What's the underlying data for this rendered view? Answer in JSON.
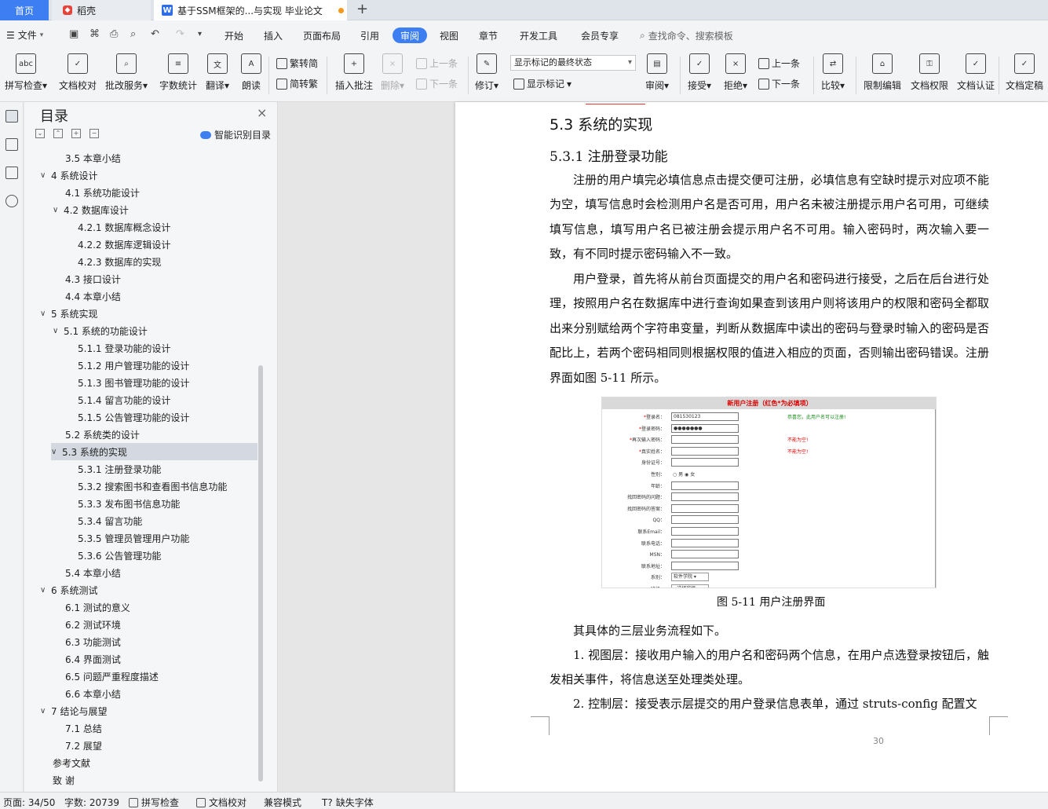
{
  "tabs": {
    "home": "首页",
    "daoke": "稻壳",
    "document": "基于SSM框架的...与实现 毕业论文"
  },
  "menu": {
    "file": "文件",
    "items": [
      "开始",
      "插入",
      "页面布局",
      "引用"
    ],
    "active": "审阅",
    "items2": [
      "视图",
      "章节",
      "开发工具",
      "会员专享"
    ],
    "search": "查找命令、搜索模板"
  },
  "ribbon": {
    "spell": "拼写检查",
    "proof": "文档校对",
    "batch": "批改服务",
    "wordcount": "字数统计",
    "translate": "翻译",
    "read": "朗读",
    "trad": "繁转简",
    "simp": "简转繁",
    "insert_comment": "插入批注",
    "delete": "删除",
    "prev": "上一条",
    "next": "下一条",
    "revise": "修订",
    "markup_state": "显示标记的最终状态",
    "show_markup": "显示标记",
    "review": "审阅",
    "accept": "接受",
    "reject": "拒绝",
    "prev2": "上一条",
    "next2": "下一条",
    "compare": "比较",
    "restrict": "限制编辑",
    "permission": "文档权限",
    "certify": "文档认证",
    "finalize": "文档定稿"
  },
  "toc": {
    "title": "目录",
    "smart": "智能识别目录",
    "items": [
      {
        "label": "3.5  本章小结",
        "level": 2,
        "arrow": ""
      },
      {
        "label": "4  系统设计",
        "level": 1,
        "arrow": "∨"
      },
      {
        "label": "4.1  系统功能设计",
        "level": 2,
        "arrow": ""
      },
      {
        "label": "4.2  数据库设计",
        "level": 2,
        "arrow": "∨"
      },
      {
        "label": "4.2.1  数据库概念设计",
        "level": 3,
        "arrow": ""
      },
      {
        "label": "4.2.2  数据库逻辑设计",
        "level": 3,
        "arrow": ""
      },
      {
        "label": "4.2.3  数据库的实现",
        "level": 3,
        "arrow": ""
      },
      {
        "label": "4.3  接口设计",
        "level": 2,
        "arrow": ""
      },
      {
        "label": "4.4  本章小结",
        "level": 2,
        "arrow": ""
      },
      {
        "label": "5  系统实现",
        "level": 1,
        "arrow": "∨"
      },
      {
        "label": "5.1  系统的功能设计",
        "level": 2,
        "arrow": "∨"
      },
      {
        "label": "5.1.1  登录功能的设计",
        "level": 3,
        "arrow": ""
      },
      {
        "label": "5.1.2  用户管理功能的设计",
        "level": 3,
        "arrow": ""
      },
      {
        "label": "5.1.3  图书管理功能的设计",
        "level": 3,
        "arrow": ""
      },
      {
        "label": "5.1.4  留言功能的设计",
        "level": 3,
        "arrow": ""
      },
      {
        "label": "5.1.5  公告管理功能的设计",
        "level": 3,
        "arrow": ""
      },
      {
        "label": "5.2  系统类的设计",
        "level": 2,
        "arrow": ""
      },
      {
        "label": "5.3  系统的实现",
        "level": 2,
        "arrow": "∨",
        "selected": true
      },
      {
        "label": "5.3.1  注册登录功能",
        "level": 3,
        "arrow": ""
      },
      {
        "label": "5.3.2  搜索图书和查看图书信息功能",
        "level": 3,
        "arrow": ""
      },
      {
        "label": "5.3.3  发布图书信息功能",
        "level": 3,
        "arrow": ""
      },
      {
        "label": "5.3.4  留言功能",
        "level": 3,
        "arrow": ""
      },
      {
        "label": "5.3.5  管理员管理用户功能",
        "level": 3,
        "arrow": ""
      },
      {
        "label": "5.3.6  公告管理功能",
        "level": 3,
        "arrow": ""
      },
      {
        "label": "5.4  本章小结",
        "level": 2,
        "arrow": ""
      },
      {
        "label": "6  系统测试",
        "level": 1,
        "arrow": "∨"
      },
      {
        "label": "6.1  测试的意义",
        "level": 2,
        "arrow": ""
      },
      {
        "label": "6.2  测试环境",
        "level": 2,
        "arrow": ""
      },
      {
        "label": "6.3  功能测试",
        "level": 2,
        "arrow": ""
      },
      {
        "label": "6.4  界面测试",
        "level": 2,
        "arrow": ""
      },
      {
        "label": "6.5  问题严重程度描述",
        "level": 2,
        "arrow": ""
      },
      {
        "label": "6.6  本章小结",
        "level": 2,
        "arrow": ""
      },
      {
        "label": "7  结论与展望",
        "level": 1,
        "arrow": "∨"
      },
      {
        "label": "7.1  总结",
        "level": 2,
        "arrow": ""
      },
      {
        "label": "7.2  展望",
        "level": 2,
        "arrow": ""
      },
      {
        "label": "参考文献",
        "level": 1,
        "arrow": ""
      },
      {
        "label": "致    谢",
        "level": 1,
        "arrow": ""
      }
    ]
  },
  "doc": {
    "heading": "5.3  系统的实现",
    "subheading": "5.3.1  注册登录功能",
    "p1": "注册的用户填完必填信息点击提交便可注册，必填信息有空缺时提示对应项不能为空，填写信息时会检测用户名是否可用，用户名未被注册提示用户名可用，可继续填写信息，填写用户名已被注册会提示用户名不可用。输入密码时，两次输入要一致，有不同时提示密码输入不一致。",
    "p2": "用户登录，首先将从前台页面提交的用户名和密码进行接受，之后在后台进行处理，按照用户名在数据库中进行查询如果查到该用户则将该用户的权限和密码全都取出来分别赋给两个字符串变量，判断从数据库中读出的密码与登录时输入的密码是否配比上，若两个密码相同则根据权限的值进入相应的页面，否则输出密码错误。注册界面如图 5-11 所示。",
    "caption": "图 5-11  用户注册界面",
    "p3": "其具体的三层业务流程如下。",
    "p4": "1.  视图层：接收用户输入的用户名和密码两个信息，在用户点选登录按钮后，触发相关事件，将信息送至处理类处理。",
    "p5": "2.  控制层：接受表示层提交的用户登录信息表单，通过 struts-config 配置文",
    "page_number": "30"
  },
  "form": {
    "header": "新用户注册（红色*为必填项）",
    "rows": [
      {
        "label": "登录名：",
        "req": true,
        "value": "081530123",
        "type": "input",
        "msg": "恭喜您，此用户名可以注册!",
        "msgColor": "#1a8a1a"
      },
      {
        "label": "登录密码：",
        "req": true,
        "value": "●●●●●●●",
        "type": "input",
        "msg": "",
        "msgColor": ""
      },
      {
        "label": "再次输入密码：",
        "req": true,
        "value": "",
        "type": "input",
        "msg": "不能为空!",
        "msgColor": "#d00"
      },
      {
        "label": "真实姓名：",
        "req": true,
        "value": "",
        "type": "input",
        "msg": "不能为空!",
        "msgColor": "#d00"
      },
      {
        "label": "身份证号：",
        "req": false,
        "value": "",
        "type": "input",
        "msg": "",
        "msgColor": ""
      },
      {
        "label": "性别：",
        "req": false,
        "value": "○ 男  ◉ 女",
        "type": "radio",
        "msg": "",
        "msgColor": ""
      },
      {
        "label": "年龄：",
        "req": false,
        "value": "",
        "type": "input",
        "msg": "",
        "msgColor": ""
      },
      {
        "label": "找回密码的问题：",
        "req": false,
        "value": "",
        "type": "input",
        "msg": "",
        "msgColor": ""
      },
      {
        "label": "找回密码的答案：",
        "req": false,
        "value": "",
        "type": "input",
        "msg": "",
        "msgColor": ""
      },
      {
        "label": "QQ：",
        "req": false,
        "value": "",
        "type": "input",
        "msg": "",
        "msgColor": ""
      },
      {
        "label": "联系Email：",
        "req": false,
        "value": "",
        "type": "input",
        "msg": "",
        "msgColor": ""
      },
      {
        "label": "联系电话：",
        "req": false,
        "value": "",
        "type": "input",
        "msg": "",
        "msgColor": ""
      },
      {
        "label": "MSN：",
        "req": false,
        "value": "",
        "type": "input",
        "msg": "",
        "msgColor": ""
      },
      {
        "label": "联系地址：",
        "req": false,
        "value": "",
        "type": "input",
        "msg": "",
        "msgColor": ""
      },
      {
        "label": "系别：",
        "req": false,
        "value": "软件学院 ▾",
        "type": "select",
        "msg": "",
        "msgColor": ""
      },
      {
        "label": "班级：",
        "req": false,
        "value": "--选择班级-- ▾",
        "type": "select",
        "msg": "",
        "msgColor": ""
      }
    ]
  },
  "status": {
    "page": "页面: 34/50",
    "words": "字数: 20739",
    "spell": "拼写检查",
    "proof": "文档校对",
    "compat": "兼容模式",
    "missing_font": "缺失字体"
  },
  "colors": {
    "accent": "#3d7ff2",
    "selected_row": "#d4d9e1"
  }
}
